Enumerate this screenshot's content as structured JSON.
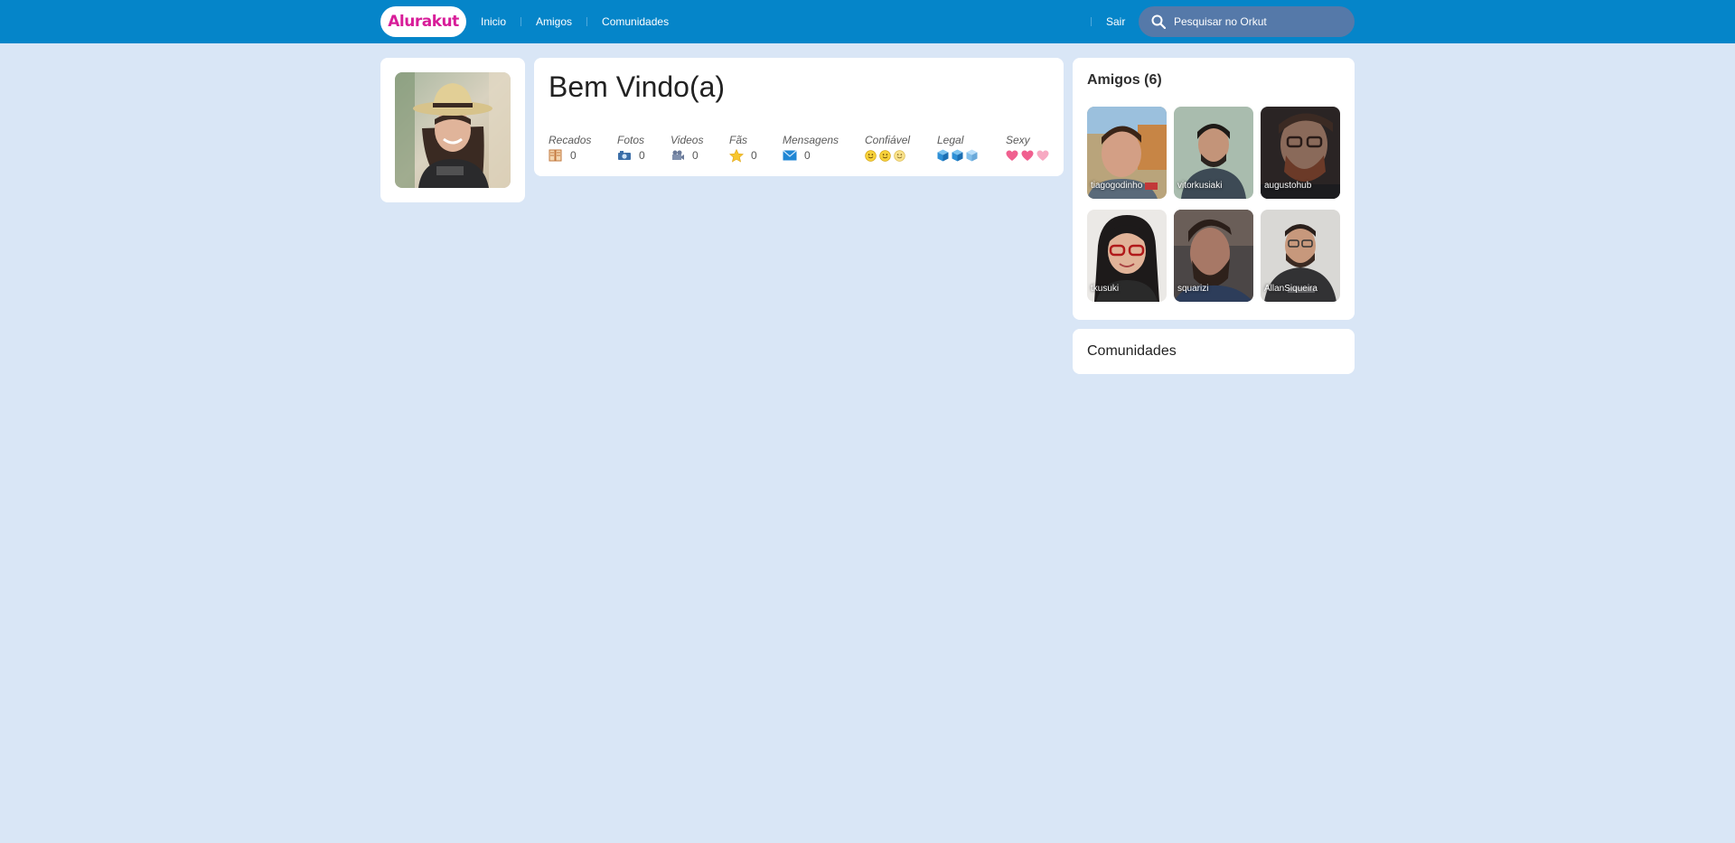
{
  "header": {
    "logo": "Alurakut",
    "nav": [
      {
        "label": "Inicio"
      },
      {
        "label": "Amigos"
      },
      {
        "label": "Comunidades"
      }
    ],
    "logout_label": "Sair",
    "search_placeholder": "Pesquisar no Orkut"
  },
  "welcome": {
    "title": "Bem Vindo(a)",
    "stats": [
      {
        "label": "Recados",
        "value": "0",
        "icon": "scrapbook-icon"
      },
      {
        "label": "Fotos",
        "value": "0",
        "icon": "camera-icon"
      },
      {
        "label": "Videos",
        "value": "0",
        "icon": "video-camera-icon"
      },
      {
        "label": "Fãs",
        "value": "0",
        "icon": "star-icon"
      },
      {
        "label": "Mensagens",
        "value": "0",
        "icon": "envelope-icon"
      },
      {
        "label": "Confiável",
        "icon": "smiley-icon",
        "rating": 3
      },
      {
        "label": "Legal",
        "icon": "ice-cube-icon",
        "rating": 3
      },
      {
        "label": "Sexy",
        "icon": "heart-icon",
        "rating": 3
      }
    ]
  },
  "friends": {
    "title": "Amigos (6)",
    "items": [
      {
        "name": "tiagogodinho"
      },
      {
        "name": "vitorkusiaki"
      },
      {
        "name": "augustohub"
      },
      {
        "name": "tkusuki"
      },
      {
        "name": "squarizi"
      },
      {
        "name": "AllanSiqueira"
      }
    ]
  },
  "communities": {
    "title": "Comunidades"
  },
  "colors": {
    "topbar": "#0585c9",
    "background": "#d9e6f6",
    "logo": "#d81d99",
    "search": "#5579a9"
  }
}
